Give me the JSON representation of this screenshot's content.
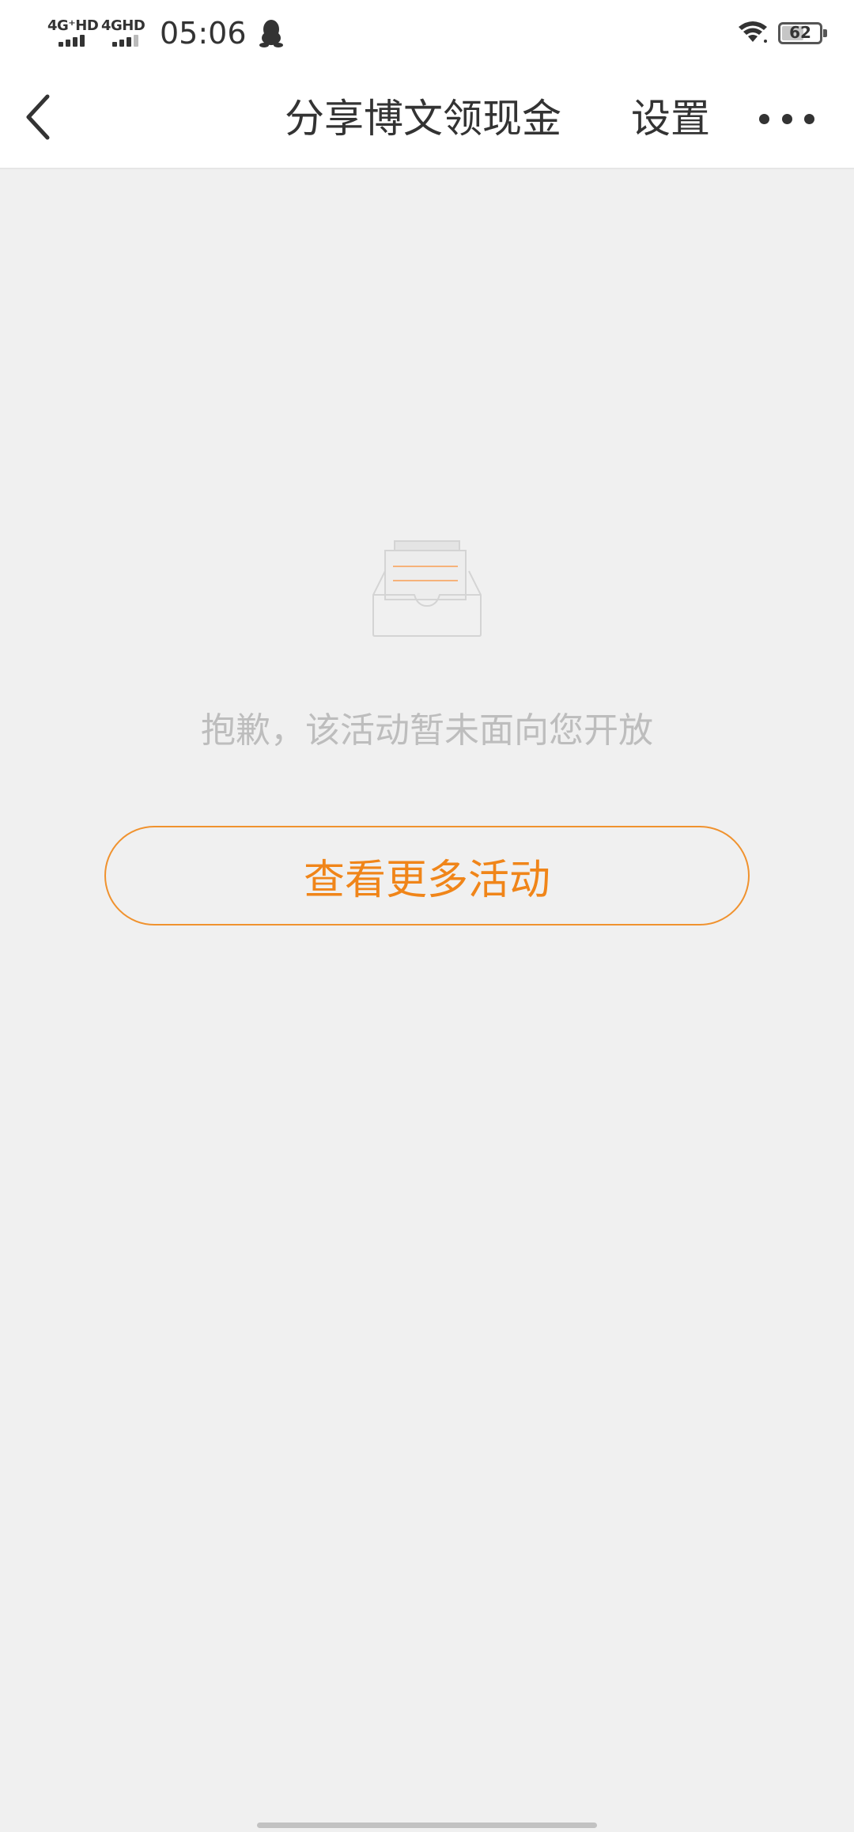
{
  "status_bar": {
    "network_1": "4G⁺HD",
    "network_2": "4GHD",
    "time": "05:06",
    "battery": "62",
    "battery_level": 0.62,
    "icons": [
      "signal-icon",
      "qq-penguin-icon",
      "wifi-icon",
      "battery-icon"
    ]
  },
  "nav": {
    "back_icon": "chevron-left-icon",
    "title": "分享博文领现金",
    "settings_label": "设置",
    "more_icon": "more-dots-icon"
  },
  "empty_state": {
    "illustration": "empty-inbox-icon",
    "message": "抱歉，该活动暂未面向您开放",
    "button_label": "查看更多活动"
  },
  "colors": {
    "accent": "#f08519",
    "background": "#f0f0f0",
    "muted_text": "#bdbdbd",
    "text": "#333333"
  }
}
